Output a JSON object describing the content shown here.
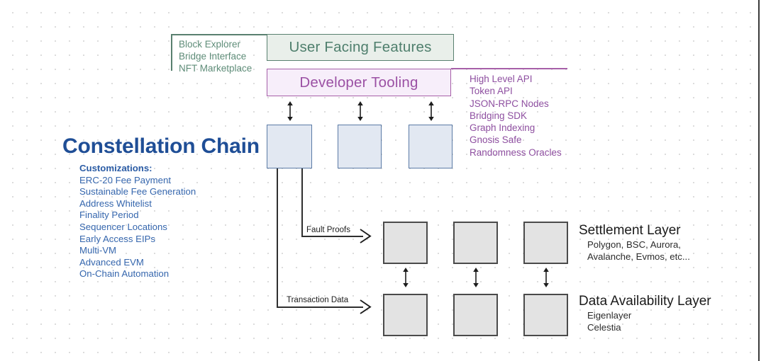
{
  "diagram": {
    "title": "Constellation Chain",
    "user_facing": {
      "box_label": "User Facing Features",
      "items": [
        "Block Explorer",
        "Bridge Interface",
        "NFT Marketplace"
      ],
      "color": "#59806f",
      "fill": "#e9efea",
      "text_color": "#4f7f6d"
    },
    "developer_tooling": {
      "box_label": "Developer Tooling",
      "items": [
        "High Level API",
        "Token API",
        "JSON-RPC Nodes",
        "Bridging SDK",
        "Graph Indexing",
        "Gnosis Safe",
        "Randomness Oracles"
      ],
      "color": "#a65fa8",
      "fill": "#f7eefa",
      "text_color": "#9b51a4"
    },
    "customizations": {
      "heading": "Customizations:",
      "items": [
        "ERC-20 Fee Payment",
        "Sustainable Fee Generation",
        "Address Whitelist",
        "Finality Period",
        "Sequencer Locations",
        "Early Access EIPs",
        "Multi-VM",
        "Advanced EVM",
        "On-Chain Automation"
      ],
      "color": "#3566ad"
    },
    "chain_nodes": {
      "count": 3,
      "fill": "#e2e8f2",
      "border": "#5b7ba6"
    },
    "settlement_layer": {
      "title": "Settlement Layer",
      "subtitle_lines": [
        "Polygon, BSC, Aurora,",
        "Avalanche, Evmos, etc..."
      ],
      "node_count": 3,
      "fill": "#e3e3e3",
      "border": "#4a4a4a"
    },
    "data_availability_layer": {
      "title": "Data Availability Layer",
      "subtitle_lines": [
        "Eigenlayer",
        "Celestia"
      ],
      "node_count": 3,
      "fill": "#e3e3e3",
      "border": "#4a4a4a"
    },
    "edges": {
      "fault_proofs": "Fault Proofs",
      "transaction_data": "Transaction Data"
    }
  }
}
